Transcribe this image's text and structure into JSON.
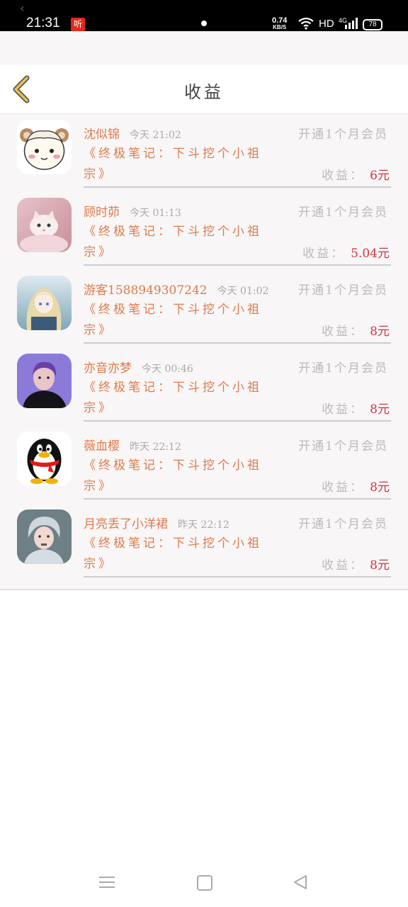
{
  "status_bar": {
    "time": "21:31",
    "ting_badge": "听",
    "net_speed": "0.74",
    "net_speed_unit": "KB/S",
    "hd": "HD",
    "network": "4G",
    "battery": "78"
  },
  "header": {
    "title": "收益",
    "back_icon": "chevron-left-icon"
  },
  "colors": {
    "accent_orange": "#e07a4a",
    "earning_red": "#d2333f",
    "muted_gray": "#bbbbbb",
    "back_yellow": "#e8c34a"
  },
  "earnings": [
    {
      "username": "沈似锦",
      "time": "今天 21:02",
      "action": "开通1个月会员",
      "book": "《终极笔记：下斗挖个小祖宗》",
      "earning_label": "收益：",
      "amount": "6元",
      "avatar": "sheep-avatar"
    },
    {
      "username": "顾时茆",
      "time": "今天 01:13",
      "action": "开通1个月会员",
      "book": "《终极笔记：下斗挖个小祖宗》",
      "earning_label": "收益：",
      "amount": "5.04元",
      "avatar": "kitten-avatar"
    },
    {
      "username": "游客15889493072​42",
      "time": "今天 01:02",
      "action": "开通1个月会员",
      "book": "《终极笔记：下斗挖个小祖宗》",
      "earning_label": "收益：",
      "amount": "8元",
      "avatar": "anime-girl-avatar"
    },
    {
      "username": "亦音亦梦",
      "time": "今天 00:46",
      "action": "开通1个月会员",
      "book": "《终极笔记：下斗挖个小祖宗》",
      "earning_label": "收益：",
      "amount": "8元",
      "avatar": "purple-portrait-avatar"
    },
    {
      "username": "薇血樱",
      "time": "昨天 22:12",
      "action": "开通1个月会员",
      "book": "《终极笔记：下斗挖个小祖宗》",
      "earning_label": "收益：",
      "amount": "8元",
      "avatar": "penguin-avatar"
    },
    {
      "username": "月亮丢了小洋裙",
      "time": "昨天 22:12",
      "action": "开通1个月会员",
      "book": "《终极笔记：下斗挖个小祖宗》",
      "earning_label": "收益：",
      "amount": "8元",
      "avatar": "portrait-avatar"
    }
  ]
}
